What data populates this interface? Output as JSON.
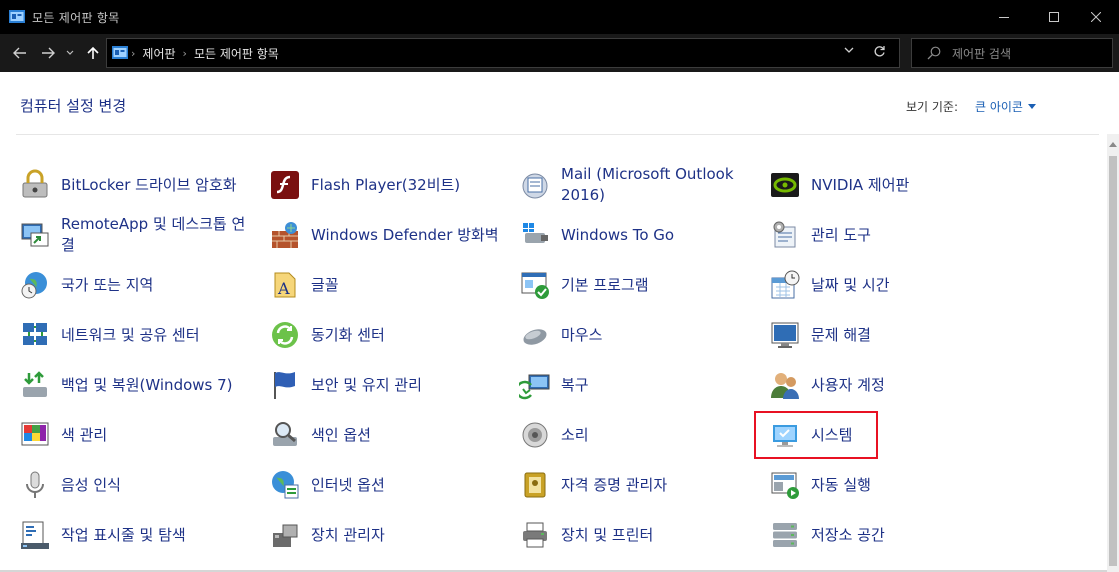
{
  "window": {
    "title": "모든 제어판 항목"
  },
  "nav": {
    "breadcrumbs": [
      "제어판",
      "모든 제어판 항목"
    ],
    "search_placeholder": "제어판 검색"
  },
  "header": {
    "title": "컴퓨터 설정 변경",
    "view_by_label": "보기 기준:",
    "view_by_value": "큰 아이콘"
  },
  "items": [
    {
      "label": "BitLocker 드라이브 암호화",
      "icon": "bitlocker-icon"
    },
    {
      "label": "Flash Player(32비트)",
      "icon": "flash-player-icon"
    },
    {
      "label": "Mail (Microsoft Outlook 2016)",
      "icon": "mail-icon"
    },
    {
      "label": "NVIDIA 제어판",
      "icon": "nvidia-icon"
    },
    {
      "label": "RemoteApp 및 데스크톱 연결",
      "icon": "remoteapp-icon"
    },
    {
      "label": "Windows Defender 방화벽",
      "icon": "firewall-icon"
    },
    {
      "label": "Windows To Go",
      "icon": "windows-to-go-icon"
    },
    {
      "label": "관리 도구",
      "icon": "admin-tools-icon"
    },
    {
      "label": "국가 또는 지역",
      "icon": "region-icon"
    },
    {
      "label": "글꼴",
      "icon": "fonts-icon"
    },
    {
      "label": "기본 프로그램",
      "icon": "default-programs-icon"
    },
    {
      "label": "날짜 및 시간",
      "icon": "date-time-icon"
    },
    {
      "label": "네트워크 및 공유 센터",
      "icon": "network-icon"
    },
    {
      "label": "동기화 센터",
      "icon": "sync-center-icon"
    },
    {
      "label": "마우스",
      "icon": "mouse-icon"
    },
    {
      "label": "문제 해결",
      "icon": "troubleshooting-icon"
    },
    {
      "label": "백업 및 복원(Windows 7)",
      "icon": "backup-icon"
    },
    {
      "label": "보안 및 유지 관리",
      "icon": "security-flag-icon"
    },
    {
      "label": "복구",
      "icon": "recovery-icon"
    },
    {
      "label": "사용자 계정",
      "icon": "user-accounts-icon"
    },
    {
      "label": "색 관리",
      "icon": "color-management-icon"
    },
    {
      "label": "색인 옵션",
      "icon": "indexing-icon"
    },
    {
      "label": "소리",
      "icon": "sound-icon"
    },
    {
      "label": "시스템",
      "icon": "system-icon"
    },
    {
      "label": "음성 인식",
      "icon": "speech-icon"
    },
    {
      "label": "인터넷 옵션",
      "icon": "internet-options-icon"
    },
    {
      "label": "자격 증명 관리자",
      "icon": "credential-manager-icon"
    },
    {
      "label": "자동 실행",
      "icon": "autoplay-icon"
    },
    {
      "label": "작업 표시줄 및 탐색",
      "icon": "taskbar-icon"
    },
    {
      "label": "장치 관리자",
      "icon": "device-manager-icon"
    },
    {
      "label": "장치 및 프린터",
      "icon": "printer-icon"
    },
    {
      "label": "저장소 공간",
      "icon": "storage-spaces-icon"
    }
  ],
  "highlighted_item": "시스템",
  "colors": {
    "link": "#1e3287",
    "highlight_border": "#e81123",
    "titlebar": "#000000"
  }
}
